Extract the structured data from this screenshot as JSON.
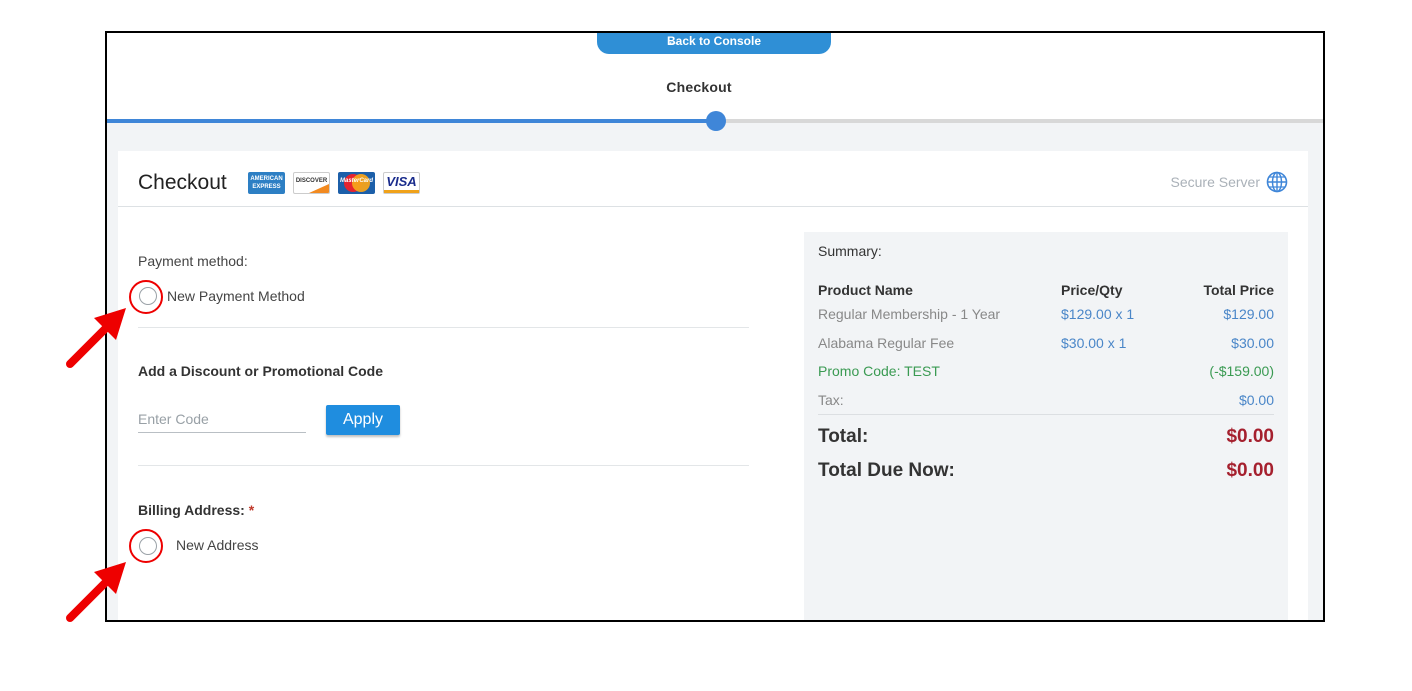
{
  "topbar": {
    "back_label": "Back to Console",
    "title": "Checkout",
    "progress_fraction": 0.5
  },
  "header": {
    "title": "Checkout",
    "card_logos": {
      "amex": "AMERICAN EXPRESS",
      "discover": "DISCOVER",
      "mastercard": "MasterCard",
      "visa": "VISA"
    },
    "secure_label": "Secure Server"
  },
  "payment": {
    "label": "Payment method:",
    "option_label": "New Payment Method"
  },
  "discount": {
    "title": "Add a Discount or Promotional Code",
    "placeholder": "Enter Code",
    "apply_label": "Apply"
  },
  "billing": {
    "label": "Billing Address:",
    "required_mark": "*",
    "option_label": "New Address"
  },
  "summary": {
    "title": "Summary:",
    "headers": {
      "name": "Product Name",
      "price_qty": "Price/Qty",
      "total": "Total Price"
    },
    "rows": [
      {
        "name": "Regular Membership - 1 Year",
        "price_qty": "$129.00 x 1",
        "total": "$129.00"
      },
      {
        "name": "Alabama Regular Fee",
        "price_qty": "$30.00 x 1",
        "total": "$30.00"
      },
      {
        "name": "Promo Code: TEST",
        "price_qty": "",
        "total": "(-$159.00)"
      },
      {
        "name": "Tax:",
        "price_qty": "",
        "total": "$0.00"
      }
    ],
    "total_label": "Total:",
    "total_value": "$0.00",
    "due_label": "Total Due Now:",
    "due_value": "$0.00"
  },
  "colors": {
    "accent": "#2f8fd6",
    "progress": "#3f86d8",
    "price_blue": "#4a86c8",
    "promo_green": "#3a9a52",
    "total_red": "#a5202e",
    "annotation_red": "#e00000"
  }
}
